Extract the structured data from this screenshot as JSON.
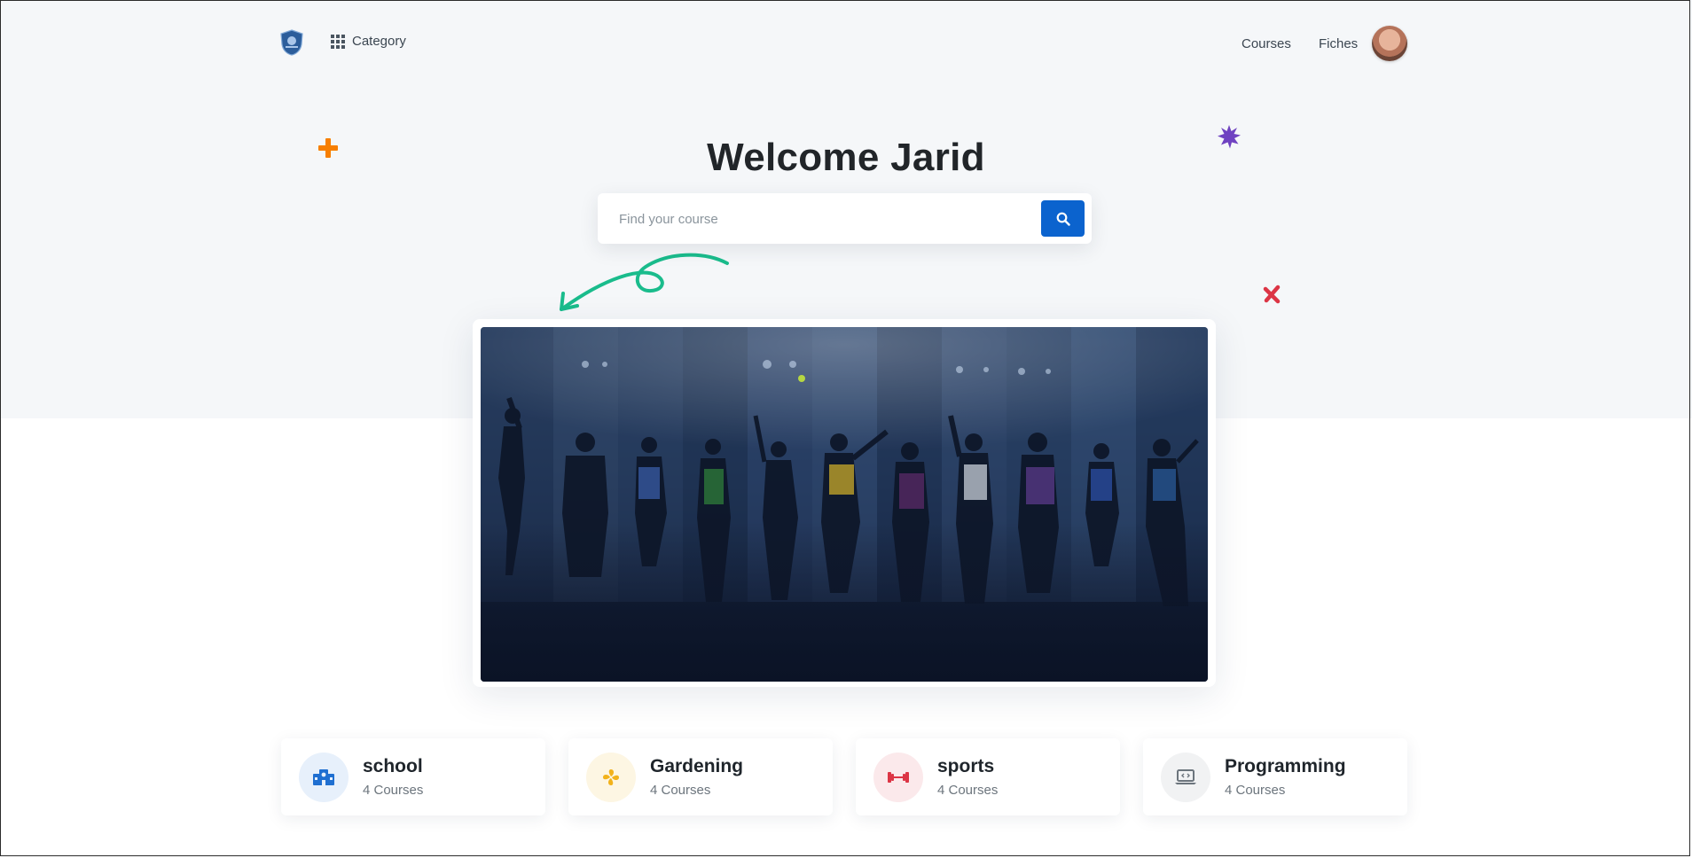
{
  "header": {
    "category_label": "Category",
    "nav": [
      {
        "label": "Courses"
      },
      {
        "label": "Fiches"
      }
    ]
  },
  "hero": {
    "title": "Welcome Jarid",
    "search_placeholder": "Find your course"
  },
  "categories": [
    {
      "title": "school",
      "count": "4 Courses",
      "icon": "school-icon",
      "color": "#1f6fd1",
      "bg": "#e7f0fb"
    },
    {
      "title": "Gardening",
      "count": "4 Courses",
      "icon": "flower-icon",
      "color": "#f2b21b",
      "bg": "#fdf6e3"
    },
    {
      "title": "sports",
      "count": "4 Courses",
      "icon": "dumbbell-icon",
      "color": "#dc3545",
      "bg": "#fbe9eb"
    },
    {
      "title": "Programming",
      "count": "4 Courses",
      "icon": "laptop-code-icon",
      "color": "#6c757d",
      "bg": "#f1f2f3"
    }
  ],
  "colors": {
    "accent": "#0b63ce",
    "plus": "#f77f00",
    "star": "#6f42c1",
    "cross": "#dc3545",
    "arrow": "#1abc8c"
  }
}
